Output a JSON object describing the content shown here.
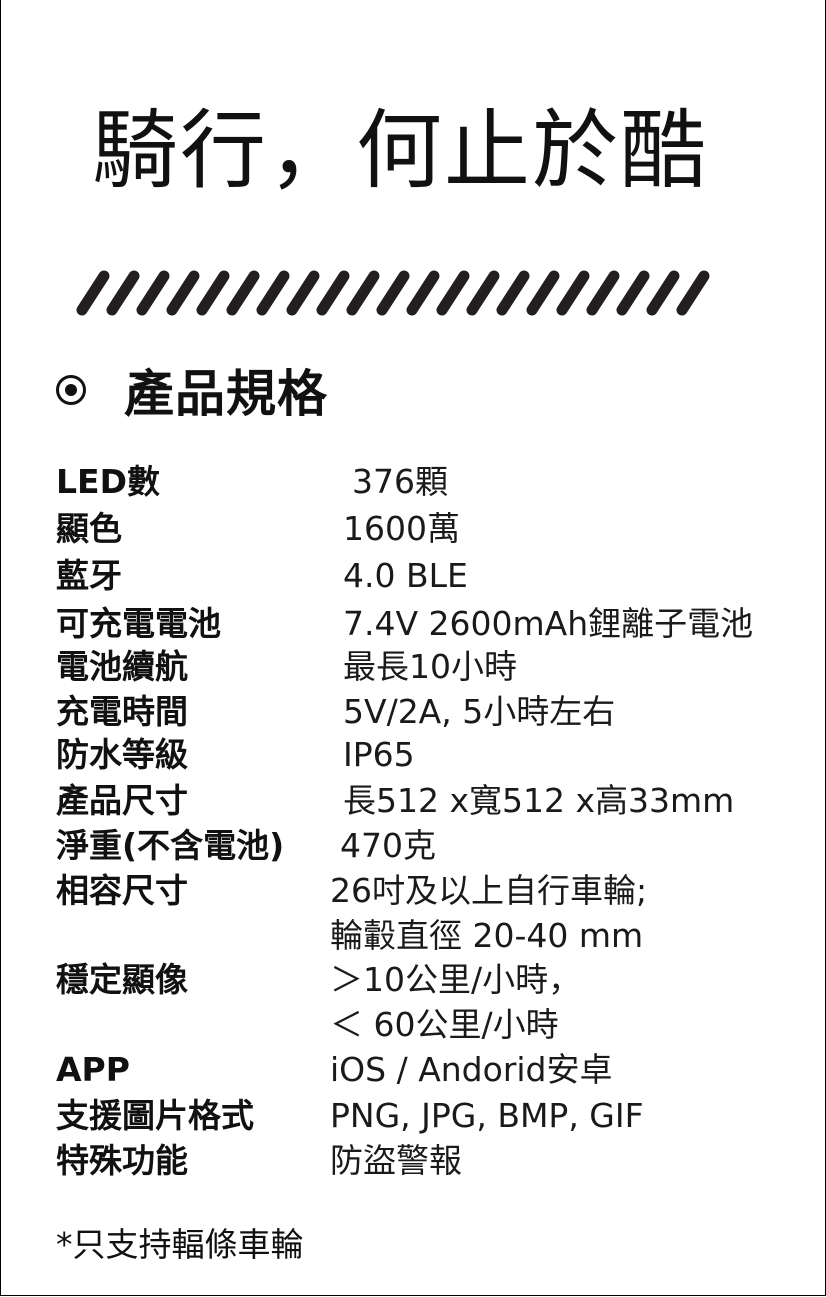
{
  "headline": "騎行，何止於酷",
  "section": {
    "icon": "radio-bullet-icon",
    "title": "產品規格"
  },
  "specs": [
    {
      "label": "LED數",
      "values": [
        "376顆"
      ]
    },
    {
      "label": "顯色",
      "values": [
        "1600萬"
      ]
    },
    {
      "label": "藍牙",
      "values": [
        "4.0 BLE"
      ]
    },
    {
      "label": "可充電電池",
      "values": [
        "7.4V 2600mAh鋰離子電池"
      ]
    },
    {
      "label": "電池續航",
      "values": [
        "最長10小時"
      ]
    },
    {
      "label": "充電時間",
      "values": [
        "5V/2A, 5小時左右"
      ]
    },
    {
      "label": "防水等級",
      "values": [
        "IP65"
      ]
    },
    {
      "label": "產品尺寸",
      "values": [
        "長512 x寬512 x高33mm"
      ]
    },
    {
      "label": "淨重(不含電池)",
      "values": [
        "470克"
      ]
    },
    {
      "label": "相容尺寸",
      "values": [
        "26吋及以上自行車輪;",
        "輪轂直徑 20-40 mm"
      ]
    },
    {
      "label": "穩定顯像",
      "values": [
        "＞10公里/小時，",
        "＜ 60公里/小時"
      ]
    },
    {
      "label": "APP",
      "values": [
        "iOS / Andorid安卓"
      ]
    },
    {
      "label": "支援圖片格式",
      "values": [
        "PNG, JPG, BMP, GIF"
      ]
    },
    {
      "label": "特殊功能",
      "values": [
        "防盜警報"
      ]
    }
  ],
  "footnote": "*只支持輻條車輪"
}
